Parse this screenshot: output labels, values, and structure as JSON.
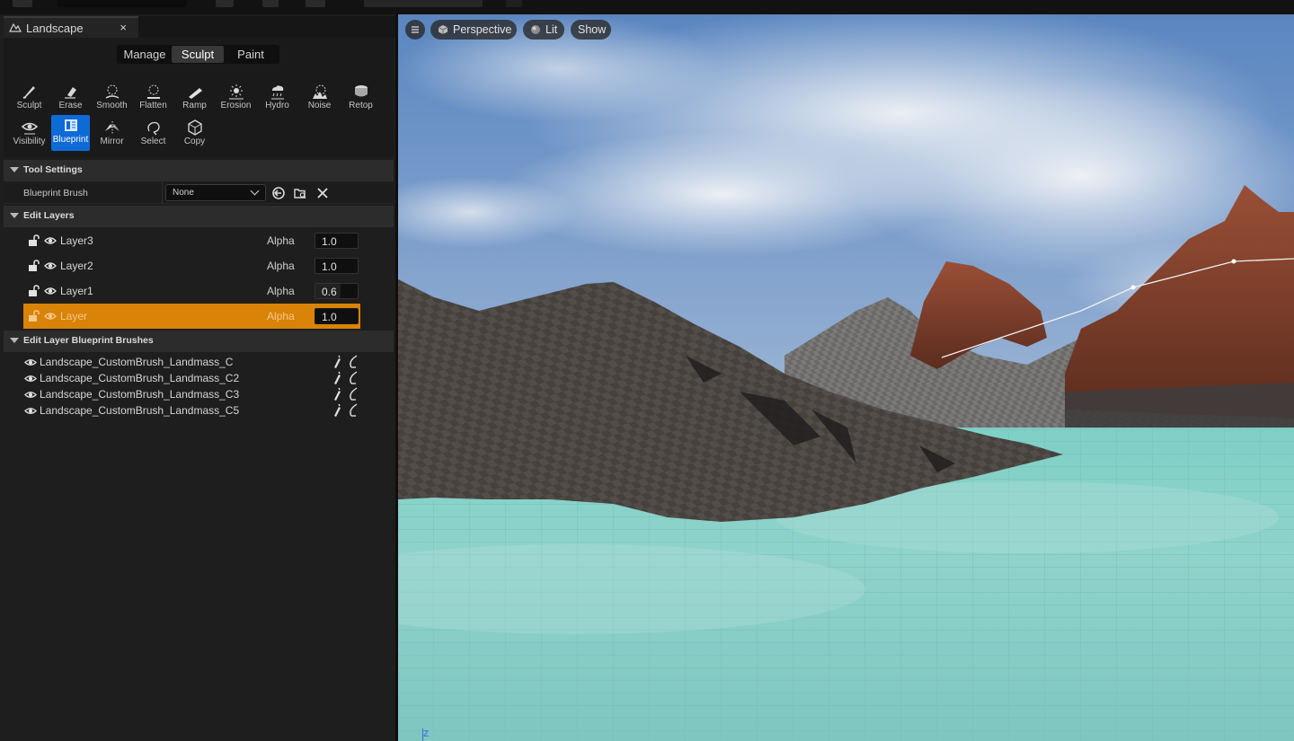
{
  "panel": {
    "tab_label": "Landscape",
    "tab_close": "×",
    "modes": [
      {
        "label": "Manage",
        "active": false
      },
      {
        "label": "Sculpt",
        "active": true
      },
      {
        "label": "Paint",
        "active": false
      }
    ],
    "tools": [
      {
        "label": "Sculpt",
        "icon": "sculpt-icon",
        "active": false
      },
      {
        "label": "Erase",
        "icon": "erase-icon",
        "active": false
      },
      {
        "label": "Smooth",
        "icon": "smooth-icon",
        "active": false
      },
      {
        "label": "Flatten",
        "icon": "flatten-icon",
        "active": false
      },
      {
        "label": "Ramp",
        "icon": "ramp-icon",
        "active": false
      },
      {
        "label": "Erosion",
        "icon": "erosion-icon",
        "active": false
      },
      {
        "label": "Hydro",
        "icon": "hydro-icon",
        "active": false
      },
      {
        "label": "Noise",
        "icon": "noise-icon",
        "active": false
      },
      {
        "label": "Retop",
        "icon": "retop-icon",
        "active": false
      },
      {
        "label": "Visibility",
        "icon": "visibility-icon",
        "active": false
      },
      {
        "label": "Blueprint",
        "icon": "blueprint-icon",
        "active": true
      },
      {
        "label": "Mirror",
        "icon": "mirror-icon",
        "active": false
      },
      {
        "label": "Select",
        "icon": "select-icon",
        "active": false
      },
      {
        "label": "Copy",
        "icon": "copy-icon",
        "active": false
      }
    ],
    "tool_settings": {
      "title": "Tool Settings",
      "blueprint_brush_label": "Blueprint Brush",
      "blueprint_brush_value": "None"
    },
    "edit_layers": {
      "title": "Edit Layers",
      "alpha_label": "Alpha",
      "layers": [
        {
          "name": "Layer3",
          "alpha": "1.0",
          "selected": false
        },
        {
          "name": "Layer2",
          "alpha": "1.0",
          "selected": false
        },
        {
          "name": "Layer1",
          "alpha": "0.6",
          "selected": false
        },
        {
          "name": "Layer",
          "alpha": "1.0",
          "selected": true
        }
      ]
    },
    "blueprint_brushes": {
      "title": "Edit Layer Blueprint Brushes",
      "items": [
        "Landscape_CustomBrush_Landmass_C",
        "Landscape_CustomBrush_Landmass_C2",
        "Landscape_CustomBrush_Landmass_C3",
        "Landscape_CustomBrush_Landmass_C5"
      ]
    }
  },
  "viewport": {
    "view_mode": "Perspective",
    "lighting": "Lit",
    "show": "Show",
    "axis_label": "Z"
  },
  "colors": {
    "accent_selected": "#d98308",
    "active_tool": "#0e6ad6",
    "water": "#8cd0c8",
    "sky": "#6f95c4"
  }
}
